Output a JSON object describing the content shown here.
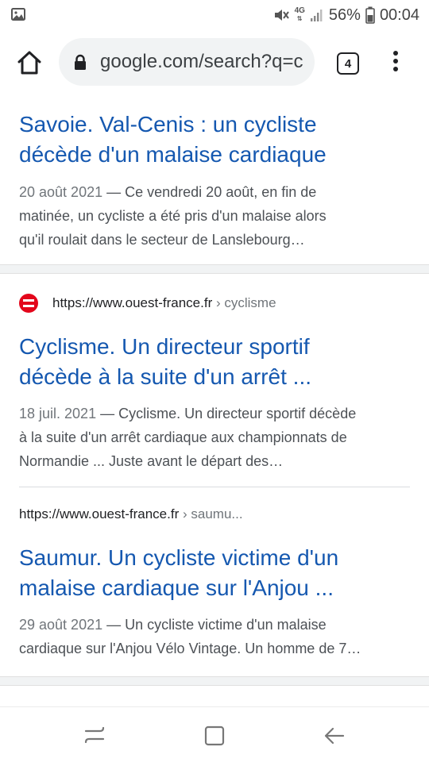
{
  "status_bar": {
    "signal_label": "4G",
    "battery_percent": "56%",
    "time": "00:04"
  },
  "browser": {
    "url": "google.com/search?q=c",
    "tab_count": "4"
  },
  "results": [
    {
      "title_lines": [
        "Savoie. Val-Cenis : un cycliste",
        "décède d'un malaise cardiaque"
      ],
      "date": "20 août 2021",
      "snippet_lines": [
        "Ce vendredi 20 août, en fin de",
        "matinée, un cycliste a été pris d'un malaise alors",
        "qu'il roulait dans le secteur de Lanslebourg…"
      ]
    },
    {
      "site": "https://www.ouest-france.fr",
      "breadcrumb": "› cyclisme",
      "title_lines": [
        "Cyclisme. Un directeur sportif",
        "décède à la suite d'un arrêt ..."
      ],
      "date": "18 juil. 2021",
      "snippet_lines": [
        "Cyclisme. Un directeur sportif décède",
        "à la suite d'un arrêt cardiaque aux championnats de",
        "Normandie ... Juste avant le départ des…"
      ]
    },
    {
      "site": "https://www.ouest-france.fr",
      "breadcrumb": "› saumu...",
      "title_lines": [
        "Saumur. Un cycliste victime d'un",
        "malaise cardiaque sur l'Anjou ..."
      ],
      "date": "29 août 2021",
      "snippet_lines": [
        "Un cycliste victime d'un malaise",
        "cardiaque sur l'Anjou Vélo Vintage. Un homme de 7…"
      ]
    }
  ],
  "icons": {
    "status": [
      "image-notification-icon",
      "mute-icon",
      "signal-icon",
      "battery-icon"
    ],
    "toolbar": [
      "home-icon",
      "lock-icon",
      "tab-switcher-icon",
      "more-vert-icon"
    ],
    "navbar": [
      "recent-apps-icon",
      "home-square-icon",
      "back-arrow-icon"
    ]
  },
  "colors": {
    "link": "#1558b0",
    "snippet": "#4d5156",
    "favicon": "#e3061b",
    "separator": "#f1f3f4"
  }
}
